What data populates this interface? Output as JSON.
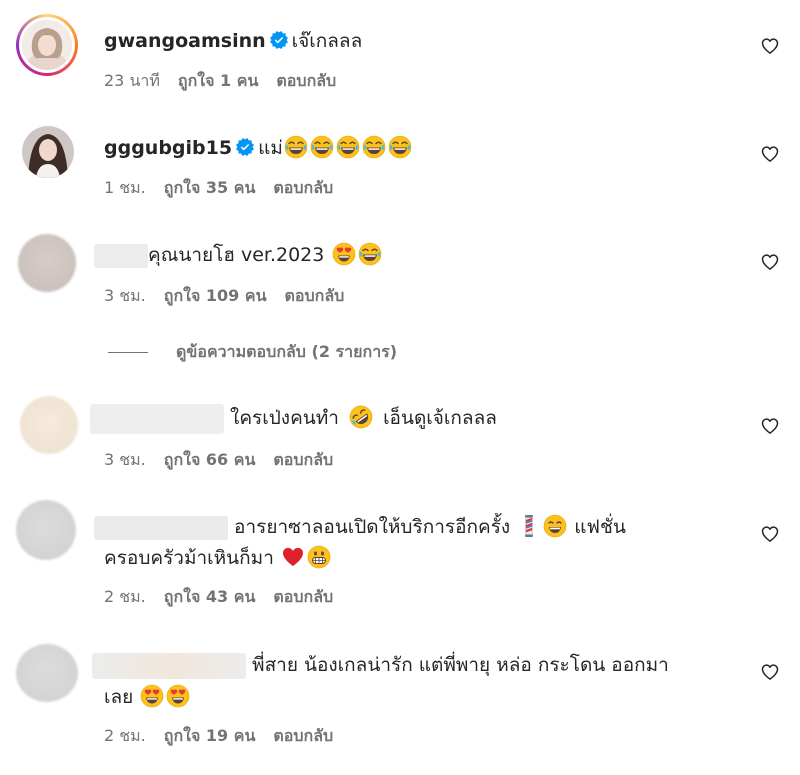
{
  "comments": [
    {
      "username": "gwangoamsinn",
      "verified": true,
      "text": "เจ๊เกลลล",
      "time": "23 นาที",
      "likes": "ถูกใจ 1 คน",
      "reply": "ตอบกลับ"
    },
    {
      "username": "gggubgib15",
      "verified": true,
      "text": "แม่",
      "time": "1 ชม.",
      "likes": "ถูกใจ 35 คน",
      "reply": "ตอบกลับ"
    },
    {
      "username": "",
      "text": "คุณนายโฮ ver.2023",
      "time": "3 ชม.",
      "likes": "ถูกใจ 109 คน",
      "reply": "ตอบกลับ",
      "view_replies": "ดูข้อความตอบกลับ (2 รายการ)"
    },
    {
      "username": "",
      "text_a": "ใครเป่งคนทำ",
      "text_b": "เอ็นดูเจ้เกลลล",
      "time": "3 ชม.",
      "likes": "ถูกใจ 66 คน",
      "reply": "ตอบกลับ"
    },
    {
      "username": "",
      "text_a": "อารยาซาลอนเปิดให้บริการอีกครั้ง",
      "text_b": "แฟชั่น",
      "text_c": "ครอบครัวม้าเหินก็มา",
      "time": "2 ชม.",
      "likes": "ถูกใจ 43 คน",
      "reply": "ตอบกลับ"
    },
    {
      "username": "",
      "text_a": "พี่สาย น้องเกลน่ารัก แต่พี่พายุ หล่อ กระโดน ออกมา",
      "text_b": "เลย",
      "time": "2 ชม.",
      "likes": "ถูกใจ 19 คน",
      "reply": "ตอบกลับ"
    }
  ],
  "colors": {
    "verified": "#0095f6",
    "meta": "#737373",
    "text": "#262626"
  }
}
